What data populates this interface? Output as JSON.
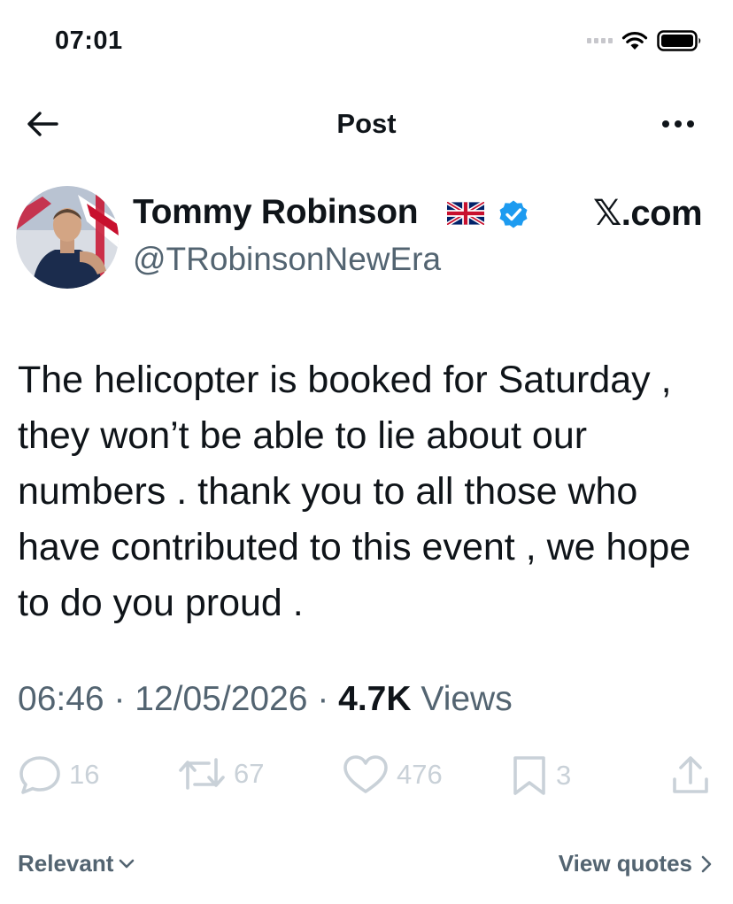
{
  "status_bar": {
    "time": "07:01"
  },
  "header": {
    "title": "Post"
  },
  "author": {
    "name": "Tommy Robinson",
    "handle": "@TRobinsonNewEra",
    "source": "𝕏.com"
  },
  "post": {
    "text": "The helicopter is booked for Saturday , they won’t be able to lie about our numbers . thank you to all those who have contributed to this event , we hope to do you proud .",
    "time": "06:46",
    "date": "12/05/2026",
    "views_count": "4.7K",
    "views_label": "Views"
  },
  "actions": {
    "replies": "16",
    "reposts": "67",
    "likes": "476",
    "bookmarks": "3"
  },
  "footer": {
    "sort_label": "Relevant",
    "view_quotes_label": "View quotes"
  },
  "colors": {
    "verified": "#1d9bf0",
    "secondary_text": "#536471",
    "faded_action": "#c9d1d8"
  }
}
